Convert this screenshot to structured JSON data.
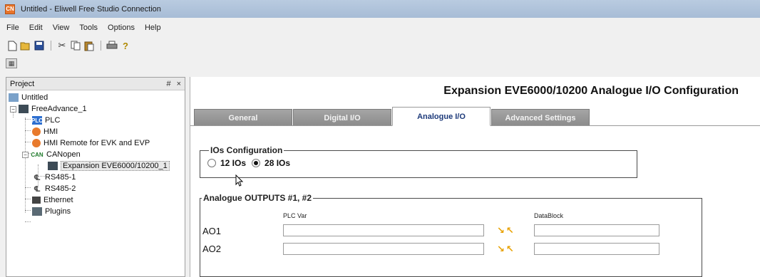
{
  "window": {
    "title": "Untitled - Eliwell Free Studio Connection",
    "app_icon": "CN"
  },
  "menu": [
    "File",
    "Edit",
    "View",
    "Tools",
    "Options",
    "Help"
  ],
  "toolbar": [
    "new-icon",
    "open-icon",
    "save-icon",
    "cut-icon",
    "copy-icon",
    "paste-icon",
    "print-icon",
    "help-icon"
  ],
  "project": {
    "header": "Project",
    "pin": "#",
    "close": "×",
    "tree": {
      "root": "Untitled",
      "free_advance": "FreeAdvance_1",
      "plc": "PLC",
      "hmi": "HMI",
      "hmi_remote": "HMI Remote for EVK and EVP",
      "canopen": "CANopen",
      "expansion": "Expansion EVE6000/10200_1",
      "rs485_1": "RS485-1",
      "rs485_2": "RS485-2",
      "ethernet": "Ethernet",
      "plugins": "Plugins"
    },
    "icon_text": {
      "plc": "PLC",
      "can": "CAN"
    }
  },
  "main": {
    "title": "Expansion EVE6000/10200 Analogue I/O Configuration",
    "tabs": [
      "General",
      "Digital I/O",
      "Analogue I/O",
      "Advanced Settings"
    ],
    "active_tab": "Analogue I/O",
    "ios_group": {
      "legend": "IOs Configuration",
      "options": [
        "12 IOs",
        "28 IOs"
      ],
      "selected": "28 IOs"
    },
    "outputs_group": {
      "legend": "Analogue OUTPUTS #1, #2",
      "col_plc_var": "PLC Var",
      "col_datablock": "DataBlock",
      "rows": [
        {
          "label": "AO1",
          "plc_var": "",
          "datablock": ""
        },
        {
          "label": "AO2",
          "plc_var": "",
          "datablock": ""
        }
      ]
    }
  },
  "colors": {
    "titlebar": "#a7bcd6",
    "tab_inactive": "#8b8b8b",
    "active_tab_text": "#1d3a7a",
    "swap_arrows": "#e8a100"
  }
}
